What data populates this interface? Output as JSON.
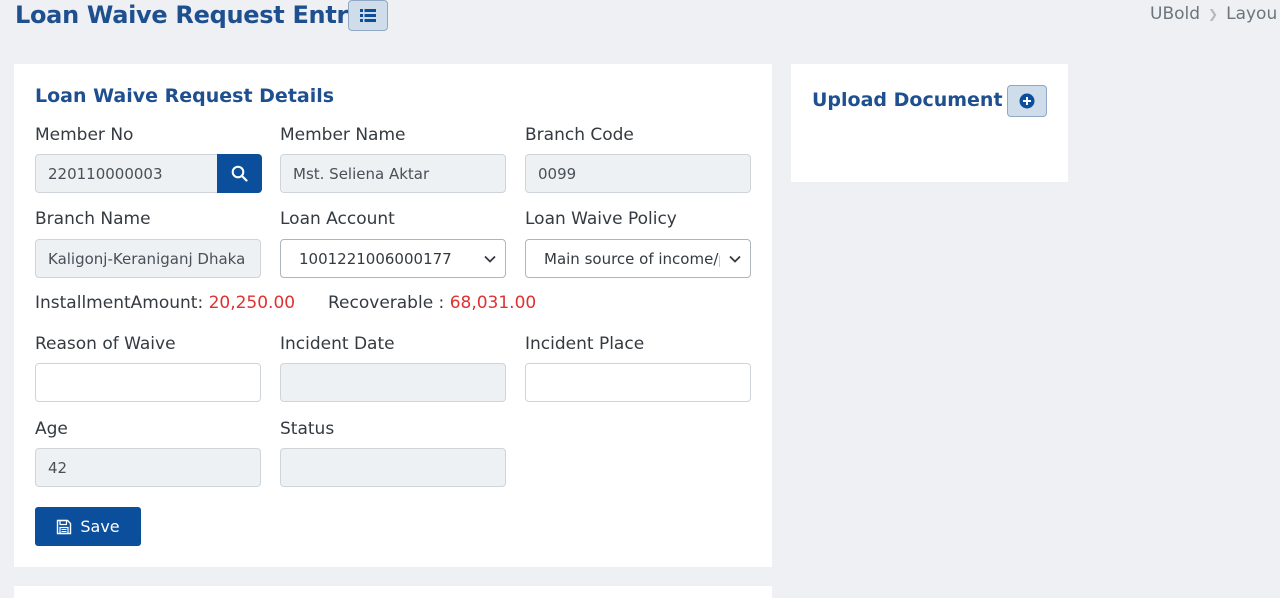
{
  "header": {
    "title": "Loan Waive Request Entry",
    "list_icon": "list-icon",
    "breadcrumb": [
      "UBold",
      "Layou"
    ]
  },
  "details": {
    "title": "Loan Waive Request Details",
    "member_no": {
      "label": "Member No",
      "value": "220110000003"
    },
    "search_icon": "search-icon",
    "member_name": {
      "label": "Member Name",
      "value": "Mst. Seliena Aktar"
    },
    "branch_code": {
      "label": "Branch Code",
      "value": "0099"
    },
    "branch_name": {
      "label": "Branch Name",
      "value": "Kaligonj-Keraniganj  Dhaka"
    },
    "loan_account": {
      "label": "Loan Account",
      "value": "1001221006000177"
    },
    "waive_policy": {
      "label": "Loan Waive Policy",
      "value": "Main source of income/p"
    },
    "installment": {
      "label": "InstallmentAmount:",
      "value": "20,250.00"
    },
    "recoverable": {
      "label": "Recoverable :",
      "value": "68,031.00"
    },
    "reason": {
      "label": "Reason of Waive",
      "value": ""
    },
    "incident_date": {
      "label": "Incident Date",
      "value": ""
    },
    "incident_place": {
      "label": "Incident Place",
      "value": ""
    },
    "age": {
      "label": "Age",
      "value": "42"
    },
    "status": {
      "label": "Status",
      "value": ""
    },
    "save_label": "Save"
  },
  "upload": {
    "title": "Upload Document",
    "add_icon": "plus-circle-icon"
  },
  "colors": {
    "primary": "#0b4f9c",
    "title": "#1e4f8f",
    "amount_red": "#e03131"
  }
}
